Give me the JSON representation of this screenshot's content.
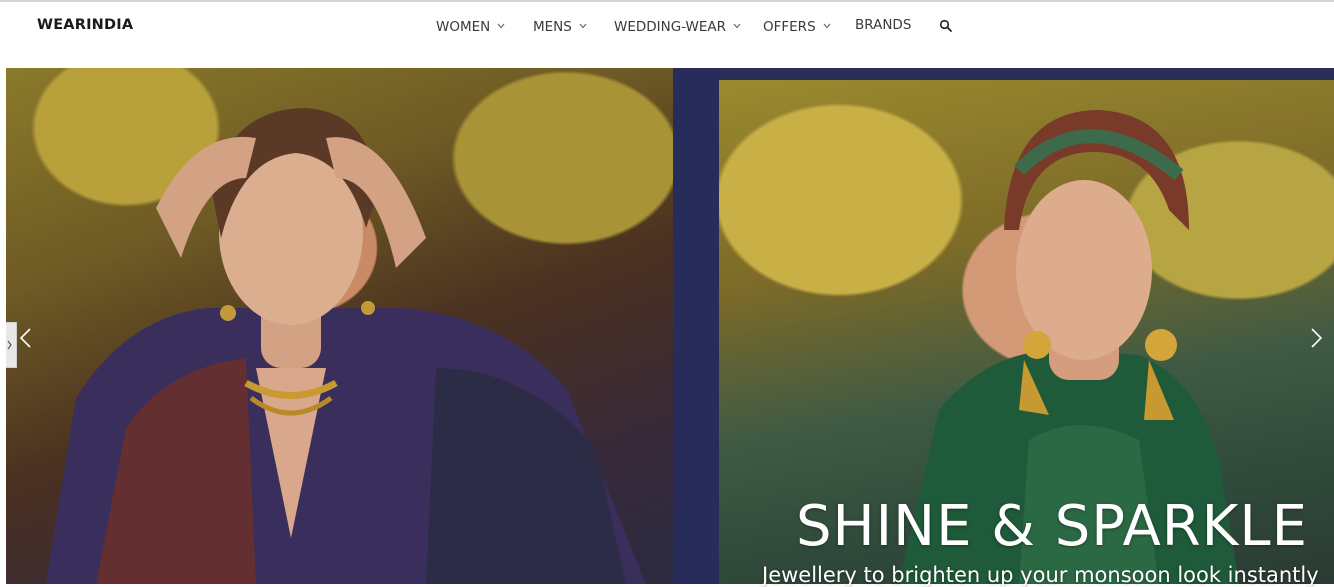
{
  "brand": {
    "logo_text": "WEARINDIA"
  },
  "nav": {
    "items": [
      {
        "label": "WOMEN",
        "has_dropdown": true
      },
      {
        "label": "MENS",
        "has_dropdown": true
      },
      {
        "label": "WEDDING-WEAR",
        "has_dropdown": true
      },
      {
        "label": "OFFERS",
        "has_dropdown": true
      },
      {
        "label": "BRANDS",
        "has_dropdown": false
      }
    ],
    "search_icon": "search-icon"
  },
  "hero": {
    "headline": "SHINE & SPARKLE",
    "subline": "Jewellery to brighten up your monsoon look instantly",
    "prev_icon": "chevron-left-icon",
    "next_icon": "chevron-right-icon"
  },
  "colors": {
    "text": "#3a3a3a",
    "logo": "#1a1a1a",
    "hero_backdrop": "#272c5a",
    "overlay_text": "#ffffff"
  }
}
